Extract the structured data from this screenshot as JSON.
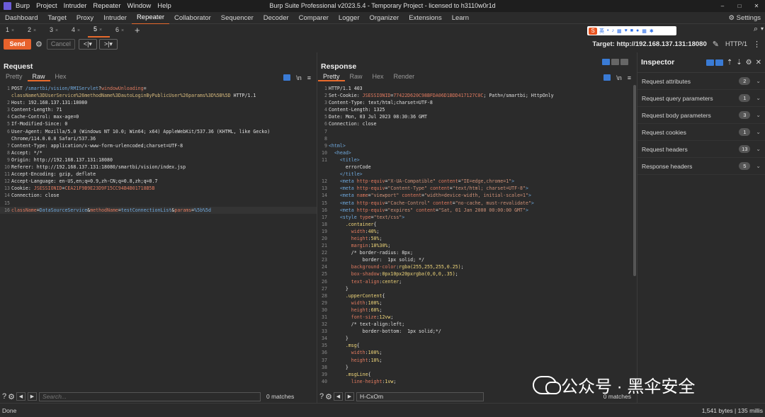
{
  "app": {
    "menu": [
      "Burp",
      "Project",
      "Intruder",
      "Repeater",
      "Window",
      "Help"
    ],
    "window_title": "Burp Suite Professional v2023.5.4 - Temporary Project - licensed to h3110w0r1d",
    "window_controls": [
      "–",
      "□",
      "✕"
    ]
  },
  "tool_tabs": [
    "Dashboard",
    "Target",
    "Proxy",
    "Intruder",
    "Repeater",
    "Collaborator",
    "Sequencer",
    "Decoder",
    "Comparer",
    "Logger",
    "Organizer",
    "Extensions",
    "Learn"
  ],
  "active_tool_tab": "Repeater",
  "settings_label": "Settings",
  "repeater_tabs": [
    "1",
    "2",
    "3",
    "4",
    "5",
    "6"
  ],
  "active_repeater_tab": "5",
  "ime_toolbar": {
    "logo": "S",
    "lang": "英"
  },
  "toolbar": {
    "send": "Send",
    "cancel": "Cancel",
    "prev": "<|▾",
    "next": ">|▾",
    "target": "Target: http://192.168.137.131:18080",
    "http_version": "HTTP/1"
  },
  "request": {
    "title": "Request",
    "tabs": [
      "Pretty",
      "Raw",
      "Hex"
    ],
    "active_tab": "Raw",
    "ln_label": "\\n",
    "search_placeholder": "Search...",
    "matches": "0 matches"
  },
  "response": {
    "title": "Response",
    "tabs": [
      "Pretty",
      "Raw",
      "Hex",
      "Render"
    ],
    "active_tab": "Pretty",
    "ln_label": "\\n",
    "search_value": "H-CxOm",
    "matches": "0 matches"
  },
  "inspector": {
    "title": "Inspector",
    "sections": [
      {
        "label": "Request attributes",
        "count": "2"
      },
      {
        "label": "Request query parameters",
        "count": "1"
      },
      {
        "label": "Request body parameters",
        "count": "3"
      },
      {
        "label": "Request cookies",
        "count": "1"
      },
      {
        "label": "Request headers",
        "count": "13"
      },
      {
        "label": "Response headers",
        "count": "5"
      }
    ]
  },
  "status": {
    "left": "Done",
    "right": "1,541 bytes | 135 millis"
  },
  "watermark": "公众号 · 黑伞安全"
}
